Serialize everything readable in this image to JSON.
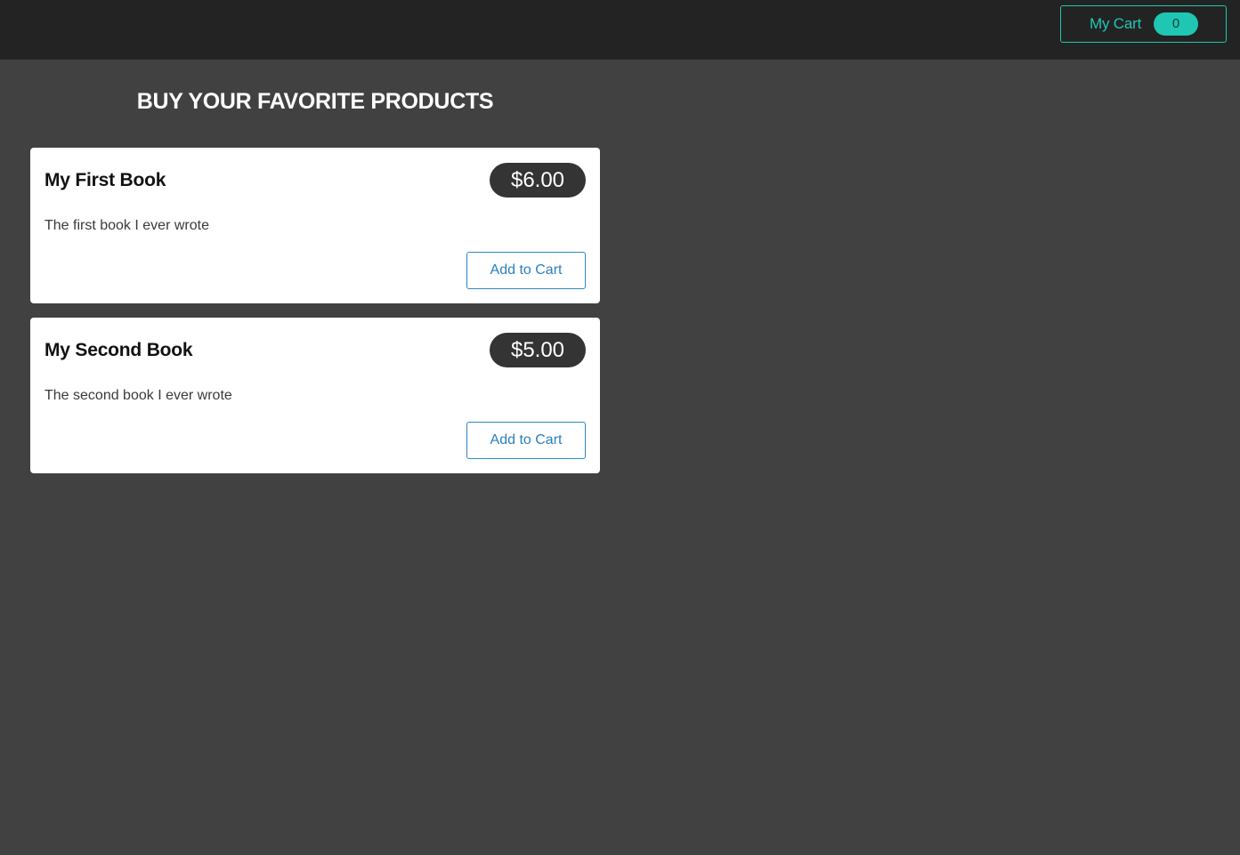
{
  "header": {
    "cart_label": "My Cart",
    "cart_count": "0"
  },
  "main": {
    "heading": "BUY YOUR FAVORITE PRODUCTS",
    "products": [
      {
        "title": "My First Book",
        "price": "$6.00",
        "description": "The first book I ever wrote",
        "button_label": "Add to Cart"
      },
      {
        "title": "My Second Book",
        "price": "$5.00",
        "description": "The second book I ever wrote",
        "button_label": "Add to Cart"
      }
    ]
  },
  "colors": {
    "page_background": "#414141",
    "header_background": "#232323",
    "accent_teal": "#1fc6b2",
    "button_blue": "#2a89c5",
    "price_badge": "#343434"
  }
}
